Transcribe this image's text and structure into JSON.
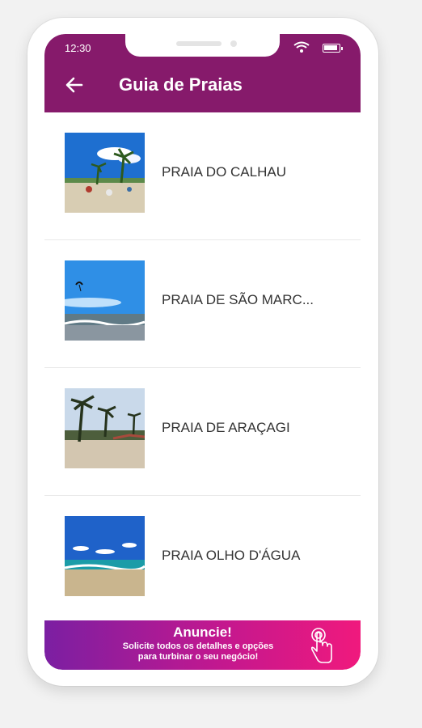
{
  "status_bar": {
    "time": "12:30"
  },
  "header": {
    "title": "Guia de Praias"
  },
  "beaches": [
    {
      "name": "PRAIA DO CALHAU"
    },
    {
      "name": "PRAIA DE SÃO MARC..."
    },
    {
      "name": "PRAIA DE ARAÇAGI"
    },
    {
      "name": "PRAIA OLHO D'ÁGUA"
    }
  ],
  "banner": {
    "title": "Anuncie!",
    "line1": "Solicite todos os detalhes e opções",
    "line2": "para turbinar o seu negócio!"
  },
  "colors": {
    "header": "#861a6b",
    "banner_start": "#7b1fa2",
    "banner_end": "#f0197d"
  }
}
